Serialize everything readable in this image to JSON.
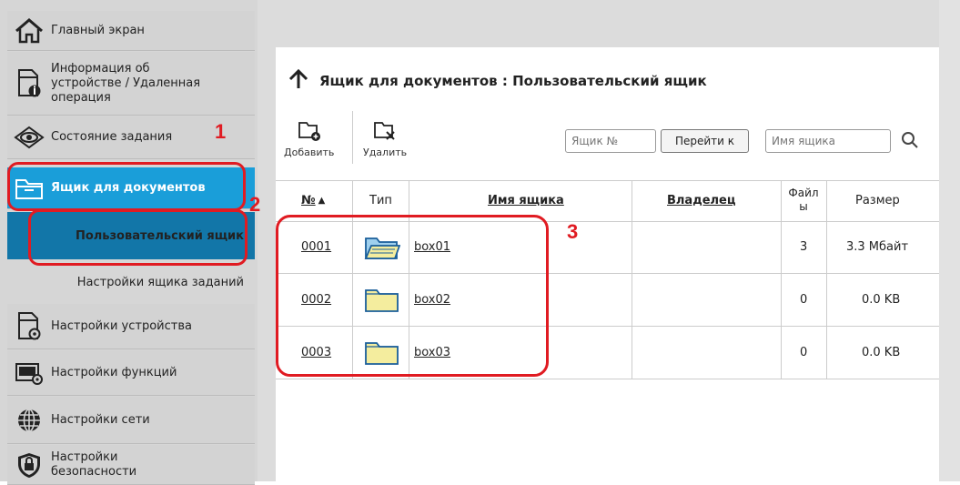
{
  "sidebar": {
    "items": [
      {
        "label": "Главный экран",
        "icon": "home-icon"
      },
      {
        "label": "Информация об устройстве / Удаленная операция",
        "icon": "device-info-icon"
      },
      {
        "label": "Состояние задания",
        "icon": "eye-icon"
      },
      {
        "label": "Ящик для документов",
        "icon": "folder-icon"
      },
      {
        "label": "Настройки устройства",
        "icon": "device-settings-icon"
      },
      {
        "label": "Настройки функций",
        "icon": "function-settings-icon"
      },
      {
        "label": "Настройки сети",
        "icon": "globe-icon"
      },
      {
        "label": "Настройки безопасности",
        "icon": "shield-lock-icon"
      }
    ],
    "subitems": [
      {
        "label": "Пользовательский ящик"
      },
      {
        "label": "Настройки ящика заданий"
      }
    ]
  },
  "main": {
    "title": "Ящик для документов : Пользовательский ящик",
    "toolbar": {
      "add_label": "Добавить",
      "delete_label": "Удалить"
    },
    "search": {
      "box_no_placeholder": "Ящик №",
      "go_label": "Перейти к",
      "box_name_placeholder": "Имя ящика"
    },
    "table": {
      "headers": {
        "no": "№",
        "type": "Тип",
        "name": "Имя ящика",
        "owner": "Владелец",
        "files": "Файл ы",
        "size": "Размер"
      },
      "rows": [
        {
          "no": "0001",
          "name": "box01",
          "owner": "",
          "files": "3",
          "size": "3.3 Мбайт",
          "open": true
        },
        {
          "no": "0002",
          "name": "box02",
          "owner": "",
          "files": "0",
          "size": "0.0 KB",
          "open": false
        },
        {
          "no": "0003",
          "name": "box03",
          "owner": "",
          "files": "0",
          "size": "0.0 KB",
          "open": false
        }
      ]
    }
  },
  "annotations": {
    "one": "1",
    "two": "2",
    "three": "3"
  },
  "colors": {
    "accent": "#1a9ed9",
    "accent_dark": "#1276a8",
    "callout": "#e01b22",
    "folder": "#f4ed9e"
  }
}
